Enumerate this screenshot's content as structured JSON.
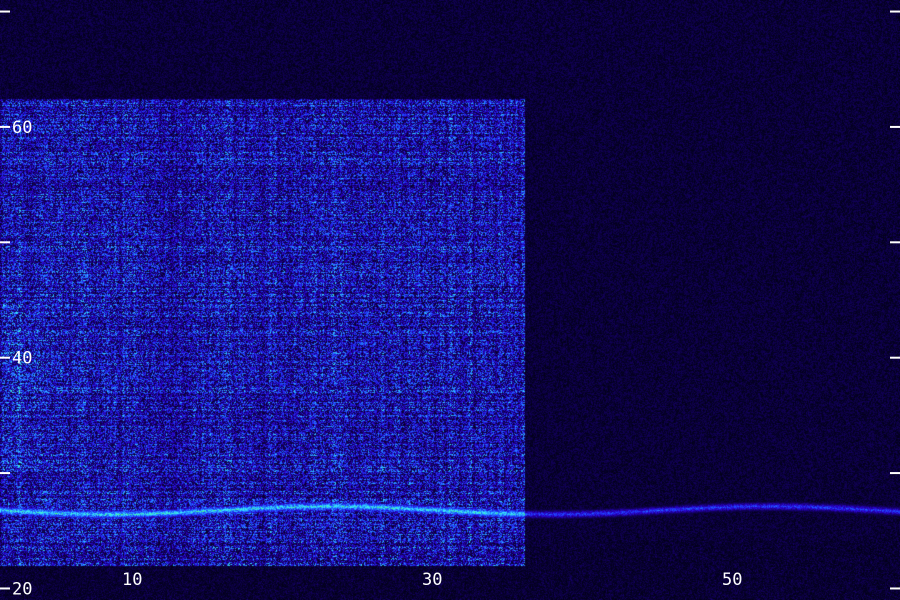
{
  "chart_data": {
    "type": "heatmap",
    "title": "",
    "xlabel": "",
    "ylabel": "",
    "xlim": [
      1,
      61
    ],
    "ylim": [
      19,
      71
    ],
    "x_tick_labels": [
      {
        "value": 10,
        "label": "10"
      },
      {
        "value": 30,
        "label": "30"
      },
      {
        "value": 50,
        "label": "50"
      }
    ],
    "y_tick_labels": [
      {
        "value": 20,
        "label": "20"
      },
      {
        "value": 40,
        "label": "40"
      },
      {
        "value": 60,
        "label": "60"
      }
    ],
    "x_major_ticks": [
      10,
      20,
      30,
      40,
      50,
      60
    ],
    "x_minor_step": 5,
    "y_major_ticks": [
      20,
      30,
      40,
      50,
      60,
      70
    ],
    "regions": [
      {
        "name": "strong-band",
        "x_range": [
          1,
          36
        ],
        "y_range": [
          22,
          62.5
        ],
        "level": 0.42
      },
      {
        "name": "quiet-band",
        "x_range": [
          36,
          61
        ],
        "y_range": [
          19,
          71
        ],
        "level": 0.12
      }
    ],
    "green_line_y": 26.8,
    "colormap": [
      "#000010",
      "#12005a",
      "#2a00c8",
      "#1e46ff",
      "#2aa0ff",
      "#3cf0ff",
      "#50ff5a"
    ]
  }
}
